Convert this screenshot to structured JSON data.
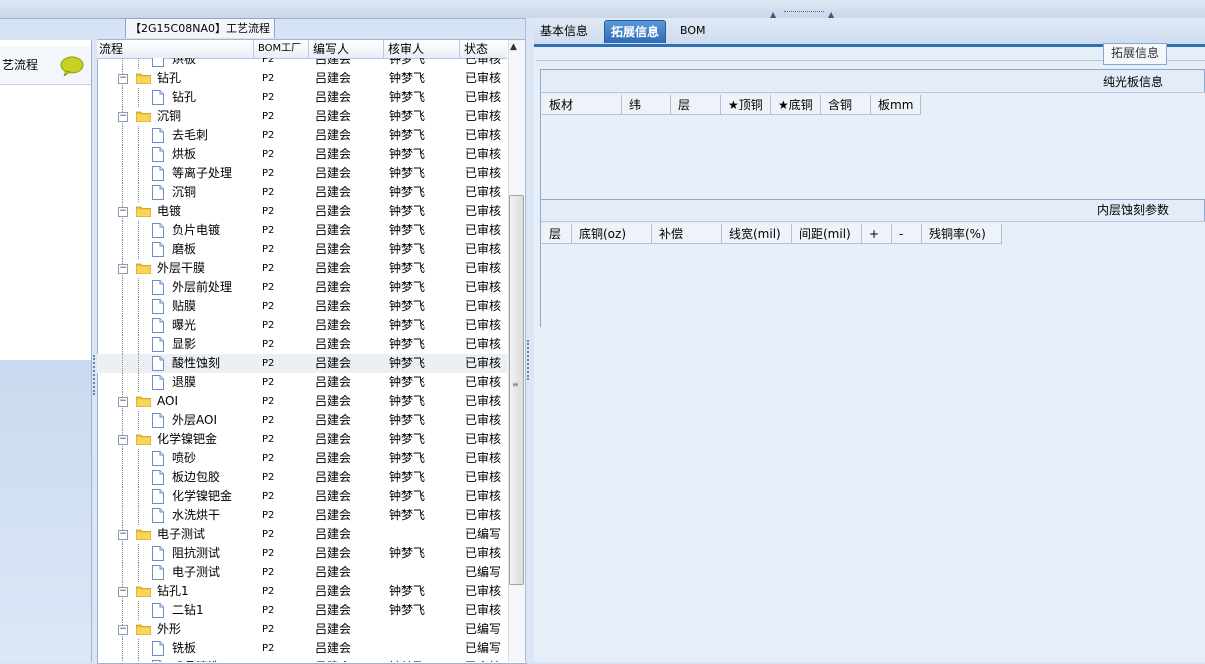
{
  "tree_panel": {
    "title": "【2G15C08NA0】工艺流程",
    "columns": [
      "流程",
      "BOM工厂",
      "编写人",
      "核审人",
      "状态"
    ]
  },
  "left_nav": {
    "label": "艺流程",
    "icon": "chat-bubble-icon"
  },
  "tree_rows": [
    {
      "name": "烘板",
      "level": 1,
      "type": "doc",
      "bom": "P2",
      "editor": "吕建会",
      "reviewer": "钟梦飞",
      "status": "已审核"
    },
    {
      "name": "钻孔",
      "level": 0,
      "type": "folder",
      "bom": "P2",
      "editor": "吕建会",
      "reviewer": "钟梦飞",
      "status": "已审核"
    },
    {
      "name": "钻孔",
      "level": 1,
      "type": "doc",
      "bom": "P2",
      "editor": "吕建会",
      "reviewer": "钟梦飞",
      "status": "已审核"
    },
    {
      "name": "沉铜",
      "level": 0,
      "type": "folder",
      "bom": "P2",
      "editor": "吕建会",
      "reviewer": "钟梦飞",
      "status": "已审核"
    },
    {
      "name": "去毛刺",
      "level": 1,
      "type": "doc",
      "bom": "P2",
      "editor": "吕建会",
      "reviewer": "钟梦飞",
      "status": "已审核"
    },
    {
      "name": "烘板",
      "level": 1,
      "type": "doc",
      "bom": "P2",
      "editor": "吕建会",
      "reviewer": "钟梦飞",
      "status": "已审核"
    },
    {
      "name": "等离子处理",
      "level": 1,
      "type": "doc",
      "bom": "P2",
      "editor": "吕建会",
      "reviewer": "钟梦飞",
      "status": "已审核"
    },
    {
      "name": "沉铜",
      "level": 1,
      "type": "doc",
      "bom": "P2",
      "editor": "吕建会",
      "reviewer": "钟梦飞",
      "status": "已审核"
    },
    {
      "name": "电镀",
      "level": 0,
      "type": "folder",
      "bom": "P2",
      "editor": "吕建会",
      "reviewer": "钟梦飞",
      "status": "已审核"
    },
    {
      "name": "负片电镀",
      "level": 1,
      "type": "doc",
      "bom": "P2",
      "editor": "吕建会",
      "reviewer": "钟梦飞",
      "status": "已审核"
    },
    {
      "name": "磨板",
      "level": 1,
      "type": "doc",
      "bom": "P2",
      "editor": "吕建会",
      "reviewer": "钟梦飞",
      "status": "已审核"
    },
    {
      "name": "外层干膜",
      "level": 0,
      "type": "folder",
      "bom": "P2",
      "editor": "吕建会",
      "reviewer": "钟梦飞",
      "status": "已审核"
    },
    {
      "name": "外层前处理",
      "level": 1,
      "type": "doc",
      "bom": "P2",
      "editor": "吕建会",
      "reviewer": "钟梦飞",
      "status": "已审核"
    },
    {
      "name": "贴膜",
      "level": 1,
      "type": "doc",
      "bom": "P2",
      "editor": "吕建会",
      "reviewer": "钟梦飞",
      "status": "已审核"
    },
    {
      "name": "曝光",
      "level": 1,
      "type": "doc",
      "bom": "P2",
      "editor": "吕建会",
      "reviewer": "钟梦飞",
      "status": "已审核"
    },
    {
      "name": "显影",
      "level": 1,
      "type": "doc",
      "bom": "P2",
      "editor": "吕建会",
      "reviewer": "钟梦飞",
      "status": "已审核"
    },
    {
      "name": "酸性蚀刻",
      "level": 1,
      "type": "doc",
      "bom": "P2",
      "editor": "吕建会",
      "reviewer": "钟梦飞",
      "status": "已审核",
      "selected": true
    },
    {
      "name": "退膜",
      "level": 1,
      "type": "doc",
      "bom": "P2",
      "editor": "吕建会",
      "reviewer": "钟梦飞",
      "status": "已审核"
    },
    {
      "name": "AOI",
      "level": 0,
      "type": "folder",
      "bom": "P2",
      "editor": "吕建会",
      "reviewer": "钟梦飞",
      "status": "已审核"
    },
    {
      "name": "外层AOI",
      "level": 1,
      "type": "doc",
      "bom": "P2",
      "editor": "吕建会",
      "reviewer": "钟梦飞",
      "status": "已审核"
    },
    {
      "name": "化学镍钯金",
      "level": 0,
      "type": "folder",
      "bom": "P2",
      "editor": "吕建会",
      "reviewer": "钟梦飞",
      "status": "已审核"
    },
    {
      "name": "喷砂",
      "level": 1,
      "type": "doc",
      "bom": "P2",
      "editor": "吕建会",
      "reviewer": "钟梦飞",
      "status": "已审核"
    },
    {
      "name": "板边包胶",
      "level": 1,
      "type": "doc",
      "bom": "P2",
      "editor": "吕建会",
      "reviewer": "钟梦飞",
      "status": "已审核"
    },
    {
      "name": "化学镍钯金",
      "level": 1,
      "type": "doc",
      "bom": "P2",
      "editor": "吕建会",
      "reviewer": "钟梦飞",
      "status": "已审核"
    },
    {
      "name": "水洗烘干",
      "level": 1,
      "type": "doc",
      "bom": "P2",
      "editor": "吕建会",
      "reviewer": "钟梦飞",
      "status": "已审核"
    },
    {
      "name": "电子测试",
      "level": 0,
      "type": "folder",
      "bom": "P2",
      "editor": "吕建会",
      "reviewer": "",
      "status": "已编写"
    },
    {
      "name": "阻抗测试",
      "level": 1,
      "type": "doc",
      "bom": "P2",
      "editor": "吕建会",
      "reviewer": "钟梦飞",
      "status": "已审核"
    },
    {
      "name": "电子测试",
      "level": 1,
      "type": "doc",
      "bom": "P2",
      "editor": "吕建会",
      "reviewer": "",
      "status": "已编写"
    },
    {
      "name": "钻孔1",
      "level": 0,
      "type": "folder",
      "bom": "P2",
      "editor": "吕建会",
      "reviewer": "钟梦飞",
      "status": "已审核"
    },
    {
      "name": "二钻1",
      "level": 1,
      "type": "doc",
      "bom": "P2",
      "editor": "吕建会",
      "reviewer": "钟梦飞",
      "status": "已审核"
    },
    {
      "name": "外形",
      "level": 0,
      "type": "folder",
      "bom": "P2",
      "editor": "吕建会",
      "reviewer": "",
      "status": "已编写"
    },
    {
      "name": "铣板",
      "level": 1,
      "type": "doc",
      "bom": "P2",
      "editor": "吕建会",
      "reviewer": "",
      "status": "已编写"
    },
    {
      "name": "成品清洗",
      "level": 1,
      "type": "doc",
      "bom": "P2",
      "editor": "吕建会",
      "reviewer": "钟梦飞",
      "status": "已审核"
    }
  ],
  "tabs": [
    "基本信息",
    "拓展信息",
    "BOM"
  ],
  "active_tab": "拓展信息",
  "ext_button": "拓展信息",
  "plain_board": {
    "title": "纯光板信息",
    "columns": [
      "板材",
      "纬",
      "层",
      "★顶铜",
      "★底铜",
      "含铜",
      "板mm"
    ]
  },
  "inner_etch": {
    "title": "内层蚀刻参数",
    "columns": [
      "层",
      "底铜(oz)",
      "补偿",
      "线宽(mil)",
      "间距(mil)",
      "+",
      "-",
      "残铜率(%)"
    ]
  },
  "colors": {
    "accent": "#2e6fb7",
    "panel_bg": "#e6eef8",
    "selected_row": "#eceff3"
  }
}
